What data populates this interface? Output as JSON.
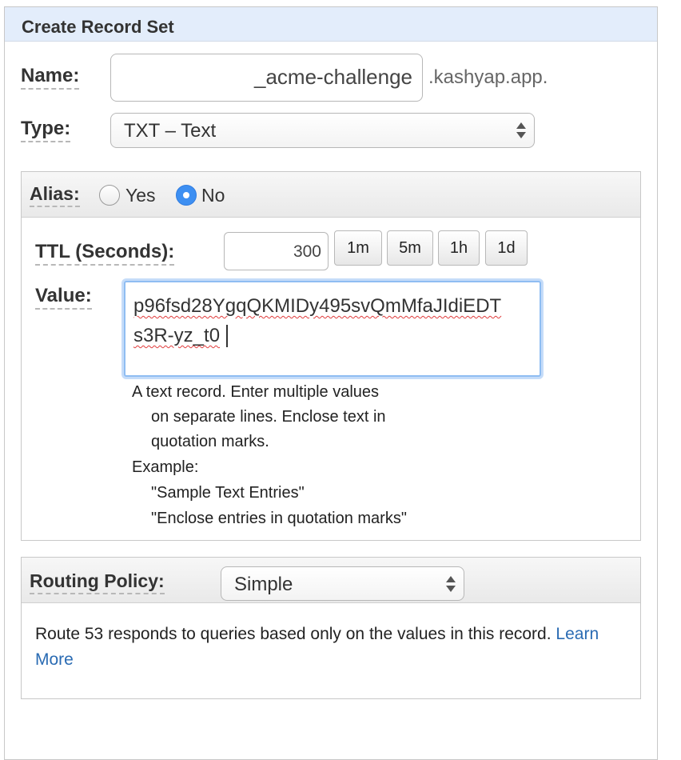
{
  "dialog": {
    "title": "Create Record Set"
  },
  "name": {
    "label": "Name:",
    "value": "_acme-challenge",
    "suffix": ".kashyap.app."
  },
  "type": {
    "label": "Type:",
    "selected": "TXT – Text"
  },
  "alias": {
    "label": "Alias:",
    "options": [
      "Yes",
      "No"
    ],
    "selected": "No"
  },
  "ttl": {
    "label": "TTL (Seconds):",
    "value": "300",
    "presets": [
      "1m",
      "5m",
      "1h",
      "1d"
    ]
  },
  "value": {
    "label": "Value:",
    "lines": [
      "p96fsd28YgqQKMIDy495svQmMfaJIdiEDT",
      "s3R-yz_t0"
    ],
    "help": [
      "A text record. Enter multiple values",
      "on separate lines. Enclose text in",
      "quotation marks.",
      "Example:",
      "\"Sample Text Entries\"",
      "\"Enclose entries in quotation marks\""
    ]
  },
  "routing": {
    "label": "Routing Policy:",
    "selected": "Simple",
    "description": "Route 53 responds to queries based only on the values in this record.",
    "link_part1": "Learn",
    "link_part2": "More"
  },
  "colors": {
    "header_bg": "#e3edfb",
    "radio_selected": "#3d8ff2",
    "link": "#2a6bb3"
  }
}
